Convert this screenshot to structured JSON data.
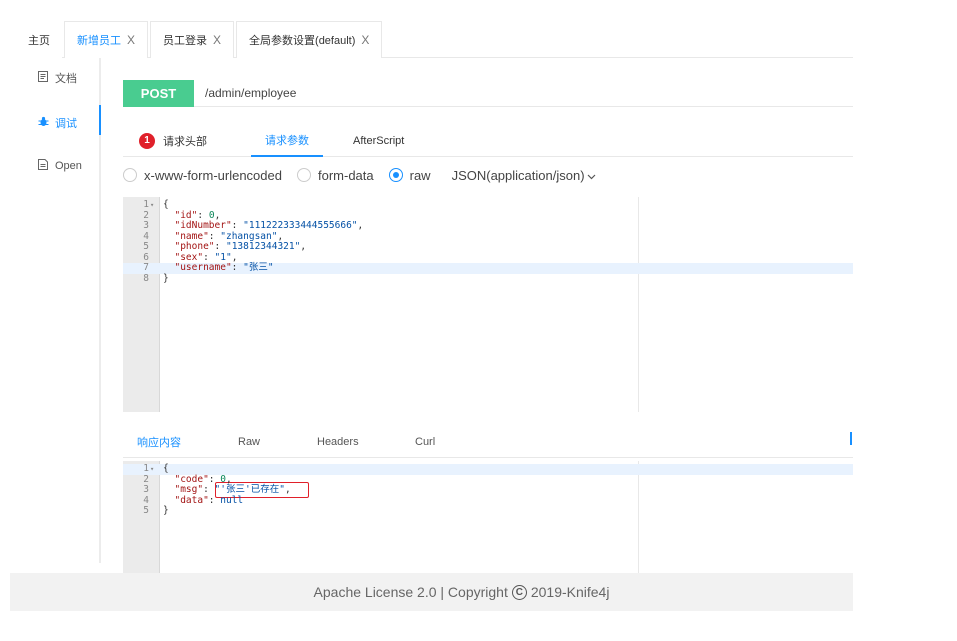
{
  "tabs": [
    {
      "label": "主页",
      "closable": false,
      "active": false
    },
    {
      "label": "新增员工",
      "closable": true,
      "active": true
    },
    {
      "label": "员工登录",
      "closable": true,
      "active": false
    },
    {
      "label": "全局参数设置(default)",
      "closable": true,
      "active": false
    }
  ],
  "tab_close_glyph": "X",
  "sidebar": {
    "items": [
      {
        "label": "文档",
        "icon": "document-icon",
        "active": false
      },
      {
        "label": "调试",
        "icon": "debug-icon",
        "active": true
      },
      {
        "label": "Open",
        "icon": "open-file-icon",
        "active": false
      }
    ]
  },
  "request": {
    "method": "POST",
    "path": "/admin/employee",
    "tabs": {
      "headers": {
        "label": "请求头部",
        "badge": "1"
      },
      "params": {
        "label": "请求参数"
      },
      "after": {
        "label": "AfterScript"
      }
    },
    "content_types": {
      "urlencoded": "x-www-form-urlencoded",
      "formdata": "form-data",
      "raw": "raw",
      "selected": "raw",
      "raw_format": "JSON(application/json)"
    },
    "body_lines": [
      "{",
      "  \"id\": 0,",
      "  \"idNumber\": \"111222333444555666\",",
      "  \"name\": \"zhangsan\",",
      "  \"phone\": \"13812344321\",",
      "  \"sex\": \"1\",",
      "  \"username\": \"张三\"",
      "}"
    ],
    "highlighted_line": 7
  },
  "response": {
    "tabs": {
      "content": "响应内容",
      "raw": "Raw",
      "headers": "Headers",
      "curl": "Curl"
    },
    "body_lines": [
      "{",
      "  \"code\": 0,",
      "  \"msg\": \"'张三'已存在\",",
      "  \"data\": null",
      "}"
    ],
    "highlighted_line": 1
  },
  "footer": {
    "prefix": "Apache License 2.0 | Copyright",
    "icon_glyph": "C",
    "suffix": "2019-Knife4j"
  },
  "colors": {
    "accent": "#1890ff",
    "post": "#49cc90",
    "badge": "#e0202a",
    "highlight_box": "#e0202a"
  }
}
